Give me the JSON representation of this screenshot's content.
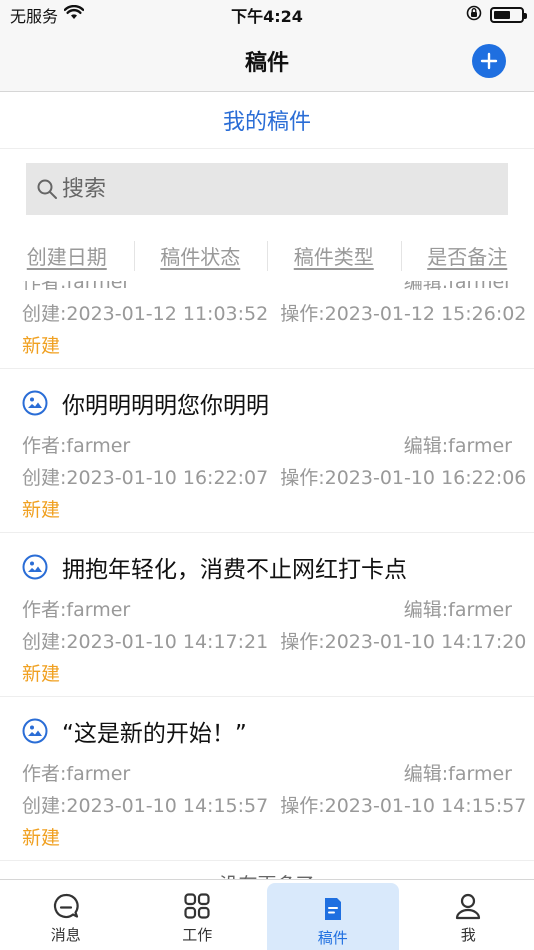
{
  "status_bar": {
    "carrier": "无服务",
    "time": "下午4:24",
    "battery_level": 0.6
  },
  "nav": {
    "title": "稿件",
    "accent_color": "#1f6fe0"
  },
  "section": {
    "title": "我的稿件"
  },
  "search": {
    "placeholder": "搜索"
  },
  "filters": [
    "创建日期",
    "稿件状态",
    "稿件类型",
    "是否备注"
  ],
  "articles": [
    {
      "title": "",
      "author": "作者:farmer",
      "editor": "编辑:farmer",
      "created": "创建:2023-01-12 11:03:52",
      "operated": "操作:2023-01-12 15:26:02",
      "status": "新建"
    },
    {
      "title": "你明明明明您你明明",
      "author": "作者:farmer",
      "editor": "编辑:farmer",
      "created": "创建:2023-01-10 16:22:07",
      "operated": "操作:2023-01-10 16:22:06",
      "status": "新建"
    },
    {
      "title": "拥抱年轻化，消费不止网红打卡点",
      "author": "作者:farmer",
      "editor": "编辑:farmer",
      "created": "创建:2023-01-10 14:17:21",
      "operated": "操作:2023-01-10 14:17:20",
      "status": "新建"
    },
    {
      "title": "“这是新的开始！”",
      "author": "作者:farmer",
      "editor": "编辑:farmer",
      "created": "创建:2023-01-10 14:15:57",
      "operated": "操作:2023-01-10 14:15:57",
      "status": "新建"
    }
  ],
  "list_footer": "没有更多了",
  "tabs": [
    {
      "label": "消息",
      "icon": "message-icon"
    },
    {
      "label": "工作",
      "icon": "grid-icon"
    },
    {
      "label": "稿件",
      "icon": "document-icon"
    },
    {
      "label": "我",
      "icon": "user-icon"
    }
  ],
  "colors": {
    "link_blue": "#2a6dd6",
    "status_orange": "#f0a020",
    "active_tab_bg": "#d9e9fb"
  }
}
